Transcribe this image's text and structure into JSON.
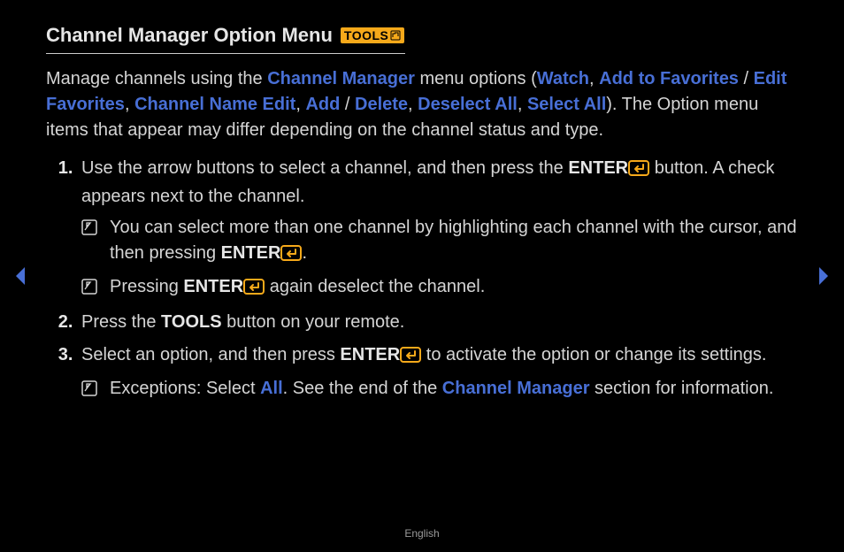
{
  "title": "Channel Manager Option Menu",
  "toolsBadge": "TOOLS",
  "intro": {
    "p1a": "Manage channels using the ",
    "hl_cm": "Channel Manager",
    "p1b": " menu options (",
    "hl_watch": "Watch",
    "sep1": ", ",
    "hl_addfav": "Add to Favorites",
    "sep_slash1": " / ",
    "hl_editfav": "Edit Favorites",
    "sep2": ", ",
    "hl_cne": "Channel Name Edit",
    "sep3": ", ",
    "hl_add": "Add",
    "sep_slash2": " / ",
    "hl_delete": "Delete",
    "sep4": ", ",
    "hl_deselect": "Deselect All",
    "sep5": ", ",
    "hl_select": "Select All",
    "p1c": "). The Option menu items that appear may differ depending on the channel status and type."
  },
  "steps": {
    "s1a": "Use the arrow buttons to select a channel, and then press the ",
    "enter": "ENTER",
    "s1b": " button. A check appears next to the channel.",
    "n1a": "You can select more than one channel by highlighting each channel with the cursor, and then pressing ",
    "n1b": ".",
    "n2a": "Pressing ",
    "n2b": " again deselect the channel.",
    "s2a": "Press the ",
    "tools": "TOOLS",
    "s2b": " button on your remote.",
    "s3a": "Select an option, and then press ",
    "s3b": " to activate the option or change its settings.",
    "n3a": "Exceptions: Select ",
    "hl_all": "All",
    "n3b": ". See the end of the ",
    "hl_cm2": "Channel Manager",
    "n3c": " section for information."
  },
  "footer": "English"
}
